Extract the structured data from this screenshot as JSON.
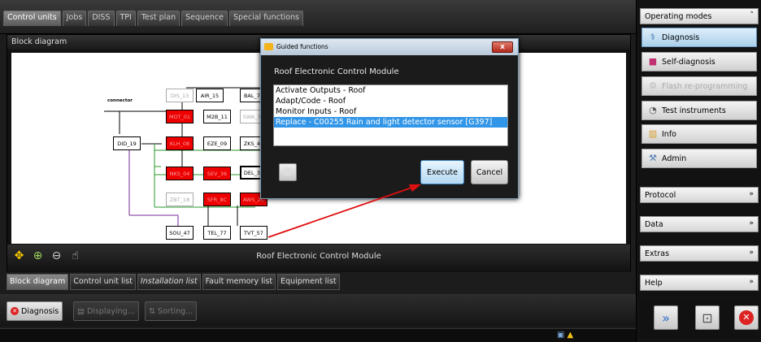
{
  "top_tabs": [
    "Control units",
    "Jobs",
    "DISS",
    "TPI",
    "Test plan",
    "Sequence",
    "Special functions"
  ],
  "main": {
    "header": "Block diagram",
    "diagram_title": "Roof Electronic Control Module",
    "connector_label": "connector",
    "modules": [
      {
        "label": "DIS_13",
        "style": "gray"
      },
      {
        "label": "AIR_15",
        "style": "normal"
      },
      {
        "label": "BAL_71",
        "style": "normal"
      },
      {
        "label": "MOT_01",
        "style": "red"
      },
      {
        "label": "M2B_11",
        "style": "normal"
      },
      {
        "label": "SWA_3C",
        "style": "gray"
      },
      {
        "label": "DID_19",
        "style": "normal"
      },
      {
        "label": "KLH_08",
        "style": "red"
      },
      {
        "label": "EZE_09",
        "style": "normal"
      },
      {
        "label": "ZKS_46",
        "style": "normal"
      },
      {
        "label": "NKS_04",
        "style": "red"
      },
      {
        "label": "SEV_36",
        "style": "red"
      },
      {
        "label": "DEL_38",
        "style": "bold"
      },
      {
        "label": "ZBT_18",
        "style": "gray"
      },
      {
        "label": "SFR_8C",
        "style": "red"
      },
      {
        "label": "AWS_2C",
        "style": "red"
      },
      {
        "label": "SOU_47",
        "style": "normal"
      },
      {
        "label": "TEL_77",
        "style": "normal"
      },
      {
        "label": "TVT_57",
        "style": "normal"
      }
    ]
  },
  "lower_tabs": [
    "Block diagram",
    "Control unit list",
    "Installation list",
    "Fault memory list",
    "Equipment list"
  ],
  "bottom_buttons": {
    "diagnosis": "Diagnosis",
    "displaying": "Displaying...",
    "sorting": "Sorting..."
  },
  "sidebar": {
    "operating_modes": "Operating modes",
    "items": [
      {
        "label": "Diagnosis",
        "icon": "stethoscope-icon"
      },
      {
        "label": "Self-diagnosis",
        "icon": "car-icon"
      },
      {
        "label": "Flash re-programming",
        "icon": "flash-icon"
      },
      {
        "label": "Test instruments",
        "icon": "gauge-icon"
      },
      {
        "label": "Info",
        "icon": "books-icon"
      },
      {
        "label": "Admin",
        "icon": "admin-icon"
      }
    ],
    "sections": [
      "Protocol",
      "Data",
      "Extras",
      "Help"
    ]
  },
  "modal": {
    "title": "Guided functions",
    "close": "x",
    "heading": "Roof Electronic Control Module",
    "options": [
      "Activate Outputs - Roof",
      "Adapt/Code - Roof",
      "Monitor Inputs - Roof",
      "Replace - C00255 Rain and light detector sensor [G397]"
    ],
    "selected_index": 3,
    "execute": "Execute",
    "cancel": "Cancel"
  },
  "colors": {
    "fault_red": "#ee0000",
    "selected_blue": "#3296e8",
    "arrow_red": "#e01010"
  }
}
